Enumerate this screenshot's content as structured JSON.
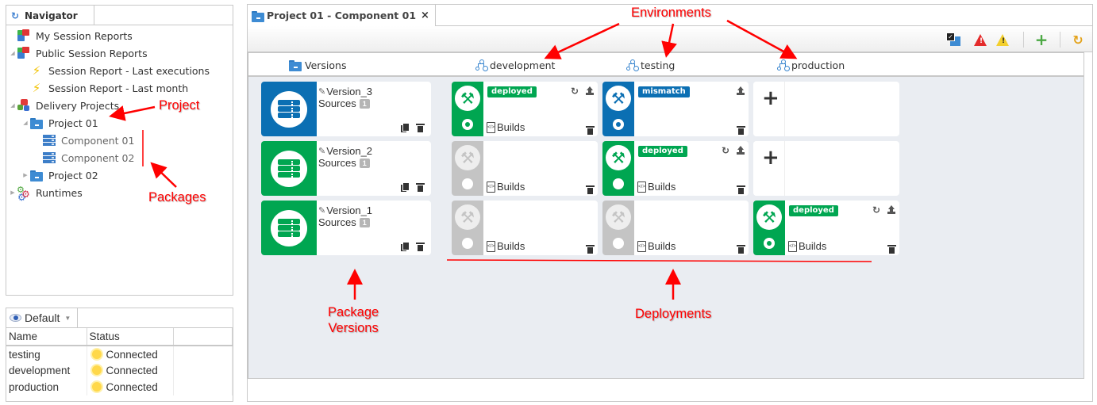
{
  "navigator": {
    "title": "Navigator",
    "tree": [
      {
        "label": "My Session Reports",
        "icon": "session-reports-icon",
        "level": 0,
        "toggle": ""
      },
      {
        "label": "Public Session Reports",
        "icon": "session-reports-icon",
        "level": 0,
        "toggle": "expanded"
      },
      {
        "label": "Session Report - Last executions",
        "icon": "lightning-icon",
        "level": 1,
        "toggle": ""
      },
      {
        "label": "Session Report - Last month",
        "icon": "lightning-icon",
        "level": 1,
        "toggle": ""
      },
      {
        "label": "Delivery Projects",
        "icon": "delivery-projects-icon",
        "level": 0,
        "toggle": "expanded"
      },
      {
        "label": "Project 01",
        "icon": "project-folder-icon",
        "level": 1,
        "toggle": "expanded"
      },
      {
        "label": "Component 01",
        "icon": "package-icon",
        "level": 2,
        "toggle": ""
      },
      {
        "label": "Component 02",
        "icon": "package-icon",
        "level": 2,
        "toggle": ""
      },
      {
        "label": "Project 02",
        "icon": "project-folder-icon",
        "level": 1,
        "toggle": "collapsed"
      },
      {
        "label": "Runtimes",
        "icon": "runtimes-icon",
        "level": 0,
        "toggle": "collapsed"
      }
    ]
  },
  "environments_panel": {
    "view_select": "Default",
    "columns": [
      "Name",
      "Status"
    ],
    "rows": [
      {
        "name": "testing",
        "status": "Connected",
        "status_icon": "sun-icon"
      },
      {
        "name": "development",
        "status": "Connected",
        "status_icon": "sun-icon"
      },
      {
        "name": "production",
        "status": "Connected",
        "status_icon": "sun-icon"
      }
    ]
  },
  "editor": {
    "tab_label": "Project 01 - Component 01",
    "toolbar": [
      "select-package-icon",
      "error-icon",
      "warning-icon",
      "add-icon",
      "refresh-icon"
    ],
    "columns": {
      "versions": "Versions",
      "environments": [
        "development",
        "testing",
        "production"
      ]
    },
    "versions": [
      {
        "name": "Version_3",
        "sources_label": "Sources",
        "sources_count": "1",
        "color": "#0b6fb3"
      },
      {
        "name": "Version_2",
        "sources_label": "Sources",
        "sources_count": "1",
        "color": "#00a651"
      },
      {
        "name": "Version_1",
        "sources_label": "Sources",
        "sources_count": "1",
        "color": "#00a651"
      }
    ],
    "deployments": [
      [
        {
          "state": "active",
          "color": "#00a651",
          "status": "deployed",
          "radio": "on",
          "builds": "Builds",
          "refresh": true,
          "upload": true
        },
        {
          "state": "active",
          "color": "#0b6fb3",
          "status": "mismatch",
          "radio": "on",
          "builds": "",
          "refresh": false,
          "upload": true
        },
        {
          "state": "empty",
          "add": "+"
        }
      ],
      [
        {
          "state": "inactive",
          "color": "#c4c4c4",
          "status": "",
          "radio": "off",
          "builds": "Builds",
          "refresh": false,
          "upload": false
        },
        {
          "state": "active",
          "color": "#00a651",
          "status": "deployed",
          "radio": "off",
          "builds": "Builds",
          "refresh": true,
          "upload": true
        },
        {
          "state": "empty",
          "add": "+"
        }
      ],
      [
        {
          "state": "inactive",
          "color": "#c4c4c4",
          "status": "",
          "radio": "off",
          "builds": "Builds",
          "refresh": false,
          "upload": false
        },
        {
          "state": "inactive",
          "color": "#c4c4c4",
          "status": "",
          "radio": "off",
          "builds": "Builds",
          "refresh": false,
          "upload": false
        },
        {
          "state": "active",
          "color": "#00a651",
          "status": "deployed",
          "radio": "on",
          "builds": "Builds",
          "refresh": true,
          "upload": true
        }
      ]
    ]
  },
  "annotations": {
    "environments": "Environments",
    "project": "Project",
    "packages": "Packages",
    "package_versions_line1": "Package",
    "package_versions_line2": "Versions",
    "deployments": "Deployments"
  },
  "colors": {
    "blue": "#0b6fb3",
    "green": "#00a651",
    "grey": "#c4c4c4",
    "annotation_red": "#ff0000",
    "content_bg": "#eaedf2"
  }
}
